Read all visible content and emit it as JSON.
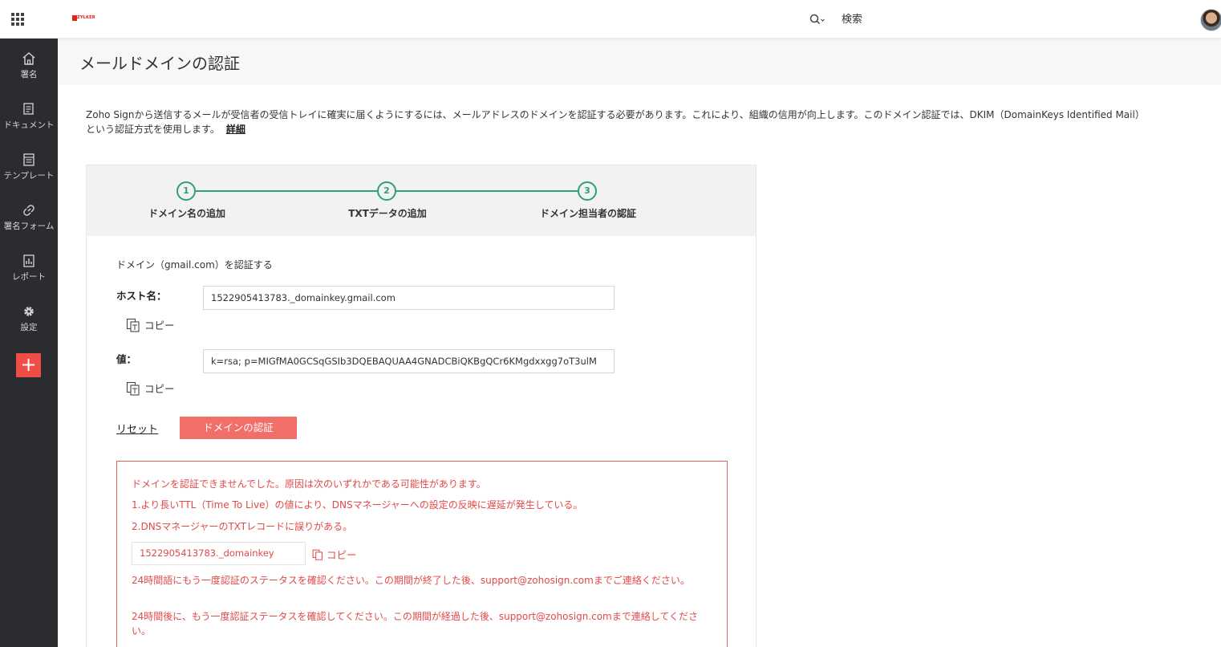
{
  "topbar": {
    "logo_text": "ZYLKER",
    "search_label": "検索",
    "icons": [
      "apps-grid-icon",
      "search-icon",
      "avatar"
    ]
  },
  "sidebar": {
    "items": [
      {
        "label": "署名",
        "icon": "home-icon"
      },
      {
        "label": "ドキュメント",
        "icon": "document-icon"
      },
      {
        "label": "テンプレート",
        "icon": "template-icon"
      },
      {
        "label": "署名フォーム",
        "icon": "link-icon"
      },
      {
        "label": "レポート",
        "icon": "report-icon"
      },
      {
        "label": "設定",
        "icon": "gear-icon"
      }
    ],
    "add_label": "+"
  },
  "page": {
    "title": "メールドメインの認証",
    "description": "Zoho Signから送信するメールが受信者の受信トレイに確実に届くようにするには、メールアドレスのドメインを認証する必要があります。これにより、組織の信用が向上します。このドメイン認証では、DKIM（DomainKeys Identified Mail）という認証方式を使用します。",
    "learn_more": "詳細"
  },
  "stepper": {
    "steps": [
      {
        "number": "1",
        "label": "ドメイン名の追加"
      },
      {
        "number": "2",
        "label": "TXTデータの追加"
      },
      {
        "number": "3",
        "label": "ドメイン担当者の認証"
      }
    ]
  },
  "form": {
    "title": "ドメイン（gmail.com）を認証する",
    "host_label": "ホスト名：",
    "host_value": "1522905413783._domainkey.gmail.com",
    "value_label": "値：",
    "value_value": "k=rsa; p=MIGfMA0GCSqGSIb3DQEBAQUAA4GNADCBiQKBgQCr6KMgdxxgg7oT3ulM",
    "copy_label": "コピー",
    "reset_label": "リセット",
    "verify_label": "ドメインの認証"
  },
  "error": {
    "line1": "ドメインを認証できませんでした。原因は次のいずれかである可能性があります。",
    "line2": "1.より長いTTL（Time To Live）の値により、DNSマネージャーへの設定の反映に遅延が発生している。",
    "line3": "2.DNSマネージャーのTXTレコードに誤りがある。",
    "txt_value": "1522905413783._domainkey",
    "copy_label": "コピー",
    "line4": "24時間語にもう一度認証のステータスを確認ください。この期間が終了した後、support@zohosign.comまでご連絡ください。",
    "line5": "24時間後に、もう一度認証ステータスを確認してください。この期間が経過した後、support@zohosign.comまで連絡してください。"
  },
  "colors": {
    "sidebar": "#2a2c30",
    "accent_red": "#ef4d45",
    "step_green": "#2e9e7d",
    "error_red": "#e14a4a"
  }
}
